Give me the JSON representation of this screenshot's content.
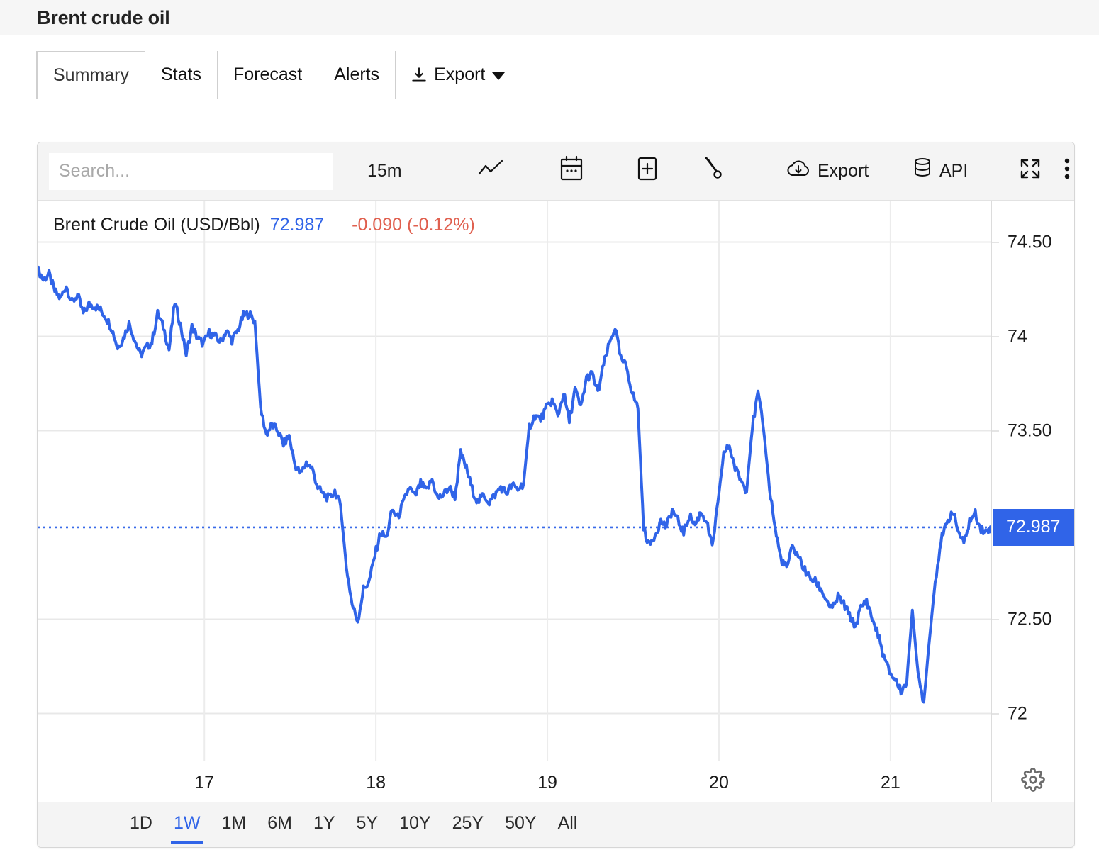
{
  "header": {
    "title": "Brent crude oil"
  },
  "tabs": [
    {
      "label": "Summary",
      "active": true
    },
    {
      "label": "Stats",
      "active": false
    },
    {
      "label": "Forecast",
      "active": false
    },
    {
      "label": "Alerts",
      "active": false
    },
    {
      "label": "Export",
      "active": false,
      "icon": "download-icon",
      "caret": true
    }
  ],
  "toolbar": {
    "search_placeholder": "Search...",
    "interval_label": "15m",
    "chart_type_icon": "line-chart-icon",
    "calendar_icon": "calendar-icon",
    "add_indicator_icon": "plus-box-icon",
    "settings_icon": "wrench-icon",
    "export_label": "Export",
    "export_icon": "cloud-download-icon",
    "api_label": "API",
    "api_icon": "database-icon",
    "fullscreen_icon": "fullscreen-icon",
    "more_icon": "more-vertical-icon"
  },
  "series_header": {
    "name": "Brent Crude Oil (USD/Bbl)",
    "last": "72.987",
    "change": "-0.090 (-0.12%)",
    "last_color": "#3064e8",
    "change_color": "#e0604f"
  },
  "axis_gear_icon": "gear-icon",
  "price_badge": {
    "value": "72.987",
    "color": "#3064e8"
  },
  "range_selector": {
    "items": [
      "1D",
      "1W",
      "1M",
      "6M",
      "1Y",
      "5Y",
      "10Y",
      "25Y",
      "50Y",
      "All"
    ],
    "active": "1W"
  },
  "chart_data": {
    "type": "line",
    "title": "Brent Crude Oil (USD/Bbl)",
    "xlabel": "",
    "ylabel": "",
    "ylim": [
      71.75,
      74.72
    ],
    "yticks": [
      74.5,
      74.0,
      73.5,
      72.5,
      72.0
    ],
    "ytick_labels": [
      "74.50",
      "74",
      "73.50",
      "72.50",
      "72"
    ],
    "xticks": [
      17,
      18,
      19,
      20,
      21
    ],
    "xtick_labels": [
      "17",
      "18",
      "19",
      "20",
      "21"
    ],
    "grid": true,
    "legend": "none",
    "series_color": "#3064e8",
    "current_price": 72.987,
    "price_line": 72.987,
    "change_abs": -0.09,
    "change_pct": -0.12,
    "interval": "15m",
    "range": "1W",
    "x": [
      0.0,
      0.6,
      1.2,
      1.8,
      2.4,
      3.0,
      3.6,
      4.2,
      4.8,
      5.4,
      6.0,
      6.6,
      7.2,
      7.8,
      8.4,
      9.0,
      9.6,
      10.2,
      10.8,
      11.4,
      12.0,
      12.6,
      13.2,
      13.8,
      14.4,
      15.0,
      15.6,
      16.2,
      16.8,
      17.4,
      18.0,
      18.6,
      19.2,
      19.8,
      20.4,
      21.0,
      21.6,
      22.2,
      22.8,
      23.4,
      24.0,
      24.6,
      25.2,
      25.8,
      26.4,
      27.0,
      27.6,
      28.2,
      28.8,
      29.4,
      30.0,
      30.6,
      31.2,
      31.8,
      32.4,
      33.0,
      33.6,
      34.2,
      34.8,
      35.4,
      36.0,
      36.6,
      37.2,
      37.8,
      38.4,
      39.0,
      39.6,
      40.2,
      40.8,
      41.4,
      42.0,
      42.6,
      43.2,
      43.8,
      44.4,
      45.0,
      45.6,
      46.2,
      46.8,
      47.4,
      48.0,
      48.6,
      49.2,
      49.8,
      50.4,
      51.0,
      51.6,
      52.2,
      52.8,
      53.4,
      54.0,
      54.6,
      55.2,
      55.8,
      56.4,
      57.0,
      57.6,
      58.2,
      58.8,
      59.4,
      60.0,
      60.6,
      61.2,
      61.8,
      62.4,
      63.0,
      63.6,
      64.2,
      64.8,
      65.4,
      66.0,
      66.6,
      67.2,
      67.8,
      68.4,
      69.0,
      69.6,
      70.2,
      70.8,
      71.4,
      72.0,
      72.6,
      73.2,
      73.8,
      74.4,
      75.0,
      75.6,
      76.2,
      76.8,
      77.4,
      78.0,
      78.6,
      79.2,
      79.8,
      80.4,
      81.0,
      81.6,
      82.2,
      82.8,
      83.4,
      84.0,
      84.6,
      85.2,
      85.8,
      86.4,
      87.0,
      87.6,
      88.2,
      88.8,
      89.4,
      90.0,
      90.6,
      91.2,
      91.8,
      92.4,
      93.0,
      93.6,
      94.2,
      94.8,
      95.4,
      96.0,
      96.6,
      97.2,
      97.8,
      98.4,
      99.0,
      99.6,
      100.0
    ],
    "y": [
      74.36,
      74.3,
      74.33,
      74.24,
      74.2,
      74.27,
      74.18,
      74.22,
      74.12,
      74.17,
      74.16,
      74.14,
      74.1,
      74.04,
      73.94,
      73.99,
      74.07,
      73.98,
      73.9,
      73.94,
      73.97,
      74.12,
      74.05,
      73.93,
      74.18,
      74.06,
      73.9,
      74.05,
      73.99,
      73.96,
      74.02,
      74.0,
      73.97,
      74.03,
      73.98,
      74.03,
      74.11,
      74.12,
      74.08,
      73.62,
      73.48,
      73.53,
      73.5,
      73.43,
      73.47,
      73.32,
      73.27,
      73.33,
      73.3,
      73.2,
      73.16,
      73.14,
      73.18,
      73.1,
      72.78,
      72.58,
      72.49,
      72.66,
      72.7,
      72.84,
      72.96,
      72.93,
      73.08,
      73.04,
      73.12,
      73.2,
      73.15,
      73.22,
      73.18,
      73.24,
      73.14,
      73.16,
      73.2,
      73.15,
      73.38,
      73.3,
      73.19,
      73.12,
      73.16,
      73.12,
      73.16,
      73.2,
      73.17,
      73.21,
      73.19,
      73.22,
      73.52,
      73.58,
      73.56,
      73.62,
      73.66,
      73.58,
      73.7,
      73.55,
      73.72,
      73.62,
      73.78,
      73.8,
      73.7,
      73.85,
      73.96,
      74.05,
      73.88,
      73.84,
      73.7,
      73.62,
      72.98,
      72.89,
      72.95,
      73.02,
      72.99,
      73.08,
      73.02,
      72.96,
      73.05,
      73.0,
      73.07,
      73.02,
      72.88,
      73.12,
      73.38,
      73.42,
      73.3,
      73.24,
      73.18,
      73.52,
      73.7,
      73.5,
      73.2,
      72.98,
      72.82,
      72.77,
      72.88,
      72.84,
      72.77,
      72.72,
      72.7,
      72.66,
      72.6,
      72.55,
      72.62,
      72.58,
      72.52,
      72.46,
      72.56,
      72.6,
      72.5,
      72.42,
      72.3,
      72.22,
      72.18,
      72.12,
      72.16,
      72.55,
      72.2,
      72.06,
      72.4,
      72.7,
      72.92,
      73.0,
      73.08,
      72.97,
      72.9,
      73.02,
      73.06,
      72.98,
      72.96,
      72.99
    ]
  }
}
